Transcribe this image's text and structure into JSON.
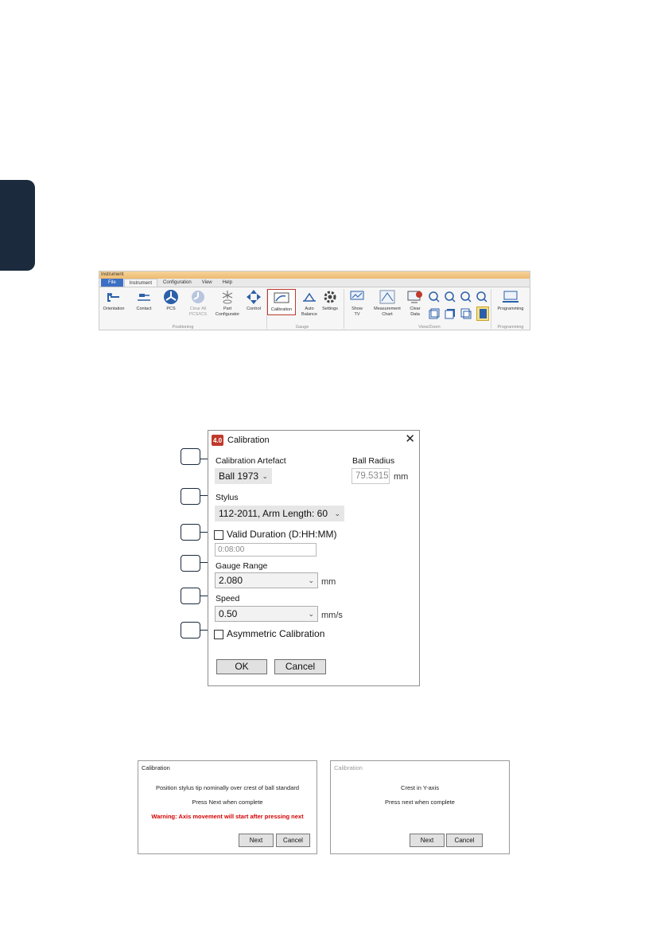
{
  "ribbon": {
    "window_title": "Instrument",
    "tabs": [
      "File",
      "Instrument",
      "Configuration",
      "View",
      "Help"
    ],
    "buttons": {
      "orientation": "Orientation",
      "contact": "Contact",
      "pcs": "PCS",
      "clear_all": "Clear All\nPCS/ICS",
      "part_configurator": "Part\nConfigurator",
      "control": "Control",
      "calibration": "Calibration",
      "auto_balance": "Auto\nBalance",
      "settings": "Settings",
      "show_tv": "Show\nTV",
      "measurement_chart": "Measurement\nChart",
      "clear_data": "Clear\nData",
      "programming": "Programming"
    },
    "groups": [
      "Positioning",
      "Gauge",
      "View/Zoom",
      "Programming"
    ]
  },
  "dialog": {
    "badge": "4.0",
    "title": "Calibration",
    "artefact_label": "Calibration Artefact",
    "artefact_value": "Ball 1973",
    "ball_radius_label": "Ball Radius",
    "ball_radius_value": "79.5315",
    "ball_radius_unit": "mm",
    "stylus_label": "Stylus",
    "stylus_value": "112-2011, Arm Length: 60",
    "valid_duration_label": "Valid Duration (D:HH:MM)",
    "valid_duration_checked": false,
    "valid_duration_value": "0:08:00",
    "gauge_range_label": "Gauge Range",
    "gauge_range_value": "2.080",
    "gauge_range_unit": "mm",
    "speed_label": "Speed",
    "speed_value": "0.50",
    "speed_unit": "mm/s",
    "asymmetric_label": "Asymmetric Calibration",
    "asymmetric_checked": false,
    "ok_label": "OK",
    "cancel_label": "Cancel"
  },
  "prompt1": {
    "title": "Calibration",
    "line1": "Position stylus tip nominally over crest of ball standard",
    "line2": "Press Next when complete",
    "warning": "Warning: Axis movement will start after pressing next",
    "next_label": "Next",
    "cancel_label": "Cancel"
  },
  "prompt2": {
    "title": "Calibration",
    "line1": "Crest in Y-axis",
    "line2": "Press next when complete",
    "next_label": "Next",
    "cancel_label": "Cancel"
  },
  "colors": {
    "accent_red": "#c0392b",
    "navy": "#1b2a3d",
    "file_tab_blue": "#3c6fc4",
    "ribbon_title_orange": "#eebb70",
    "warning_red": "#d40000"
  }
}
